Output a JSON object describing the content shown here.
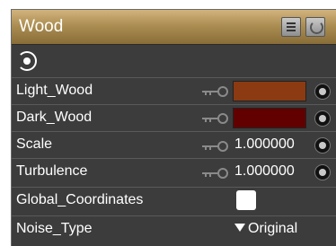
{
  "panel": {
    "title": "Wood"
  },
  "header_buttons": {
    "list_icon": "list-icon",
    "refresh_icon": "refresh-icon"
  },
  "properties": [
    {
      "label": "Light_Wood",
      "kind": "color",
      "color": "#8B3A12"
    },
    {
      "label": "Dark_Wood",
      "kind": "color",
      "color": "#620000"
    },
    {
      "label": "Scale",
      "kind": "number",
      "value": "1.000000"
    },
    {
      "label": "Turbulence",
      "kind": "number",
      "value": "1.000000"
    },
    {
      "label": "Global_Coordinates",
      "kind": "checkbox",
      "checked": false
    },
    {
      "label": "Noise_Type",
      "kind": "dropdown",
      "value": "Original"
    }
  ]
}
